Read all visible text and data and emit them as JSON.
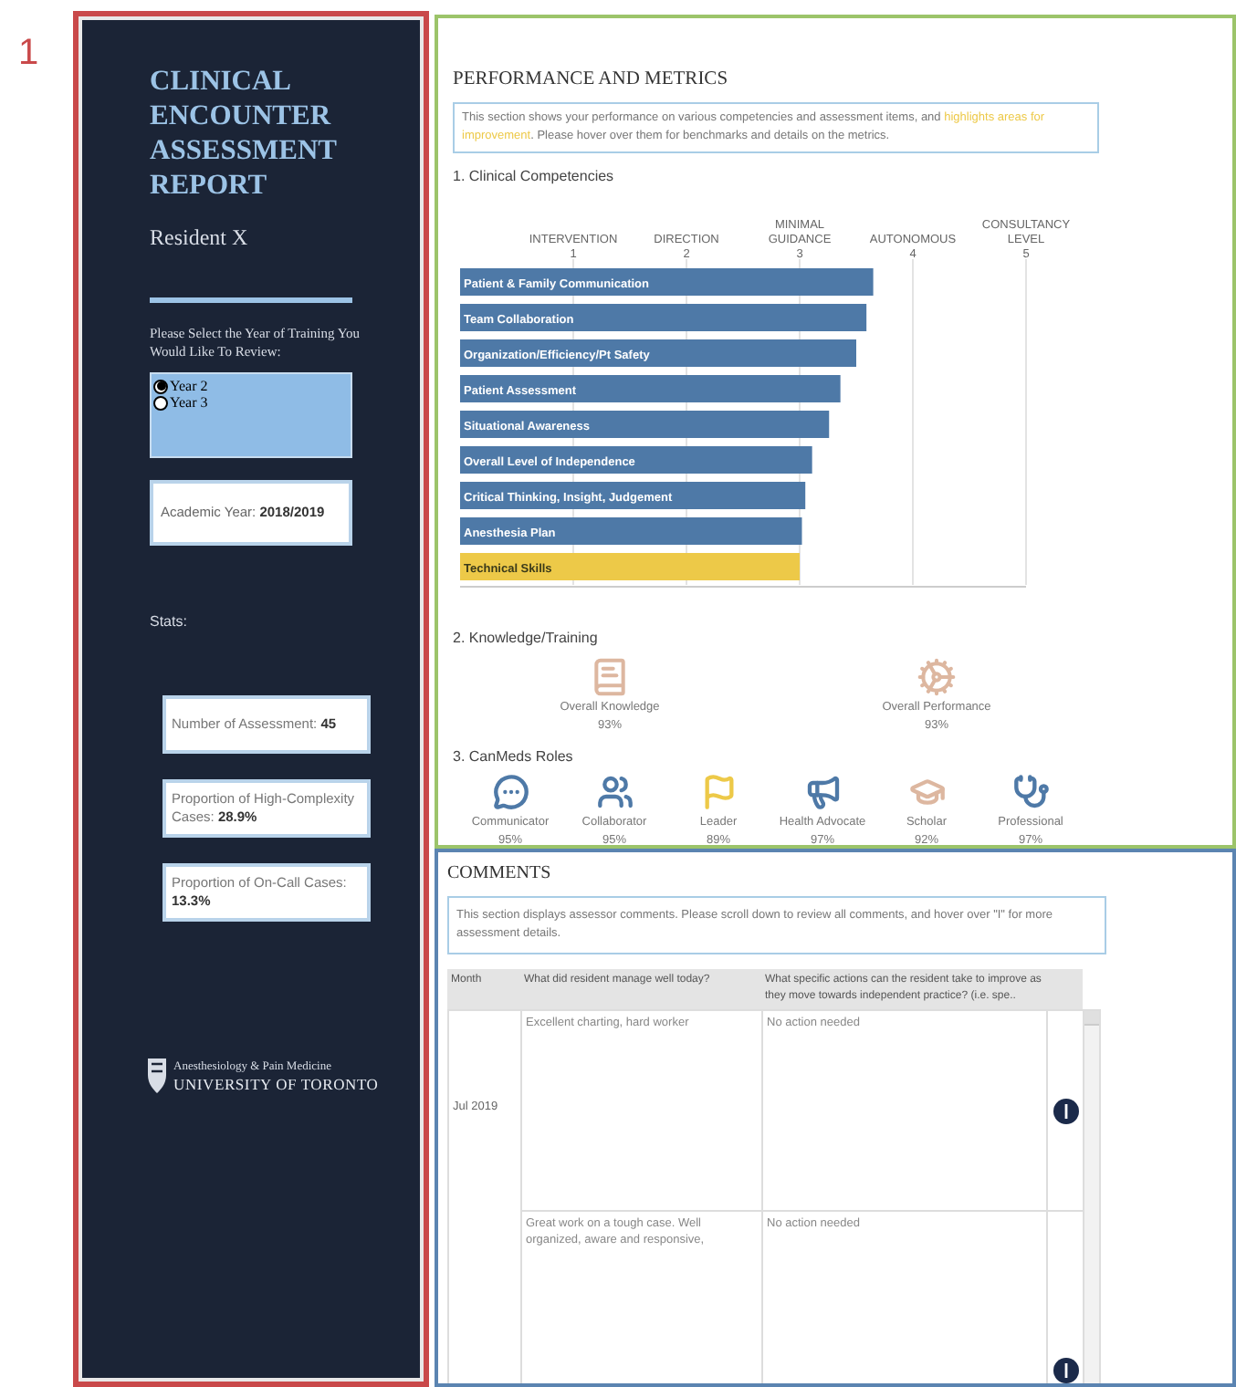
{
  "figure_number": "1",
  "sidebar": {
    "title": "CLINICAL ENCOUNTER ASSESSMENT REPORT",
    "subtitle": "Resident X",
    "prompt": "Please Select the Year of Training You Would Like To Review:",
    "years": [
      {
        "label": "Year 2",
        "selected": true
      },
      {
        "label": "Year 3",
        "selected": false
      }
    ],
    "academic_year": {
      "label": "Academic Year:",
      "value": "2018/2019"
    },
    "stats_heading": "Stats:",
    "stats": [
      {
        "label": "Number of Assessment:",
        "value": "45"
      },
      {
        "label": "Proportion of High-Complexity Cases:",
        "value": "28.9%"
      },
      {
        "label": "Proportion of On-Call Cases:",
        "value": "13.3%"
      }
    ],
    "logo": {
      "department": "Anesthesiology & Pain Medicine",
      "university": "UNIVERSITY OF TORONTO"
    }
  },
  "performance": {
    "title": "PERFORMANCE AND METRICS",
    "description": {
      "before": "This section shows your performance on various competencies and assessment items, and ",
      "highlight": "highlights areas for improvement",
      "after": ". Please hover over them for benchmarks and details on the metrics."
    },
    "competencies": {
      "heading": "1. Clinical Competencies",
      "chart_data": {
        "type": "bar",
        "orientation": "horizontal",
        "categories": [
          "Patient & Family Communication",
          "Team Collaboration",
          "Organization/Efficiency/Pt Safety",
          "Patient Assessment",
          "Situational Awareness",
          "Overall Level of Independence",
          "Critical Thinking, Insight, Judgement",
          "Anesthesia Plan",
          "Technical Skills"
        ],
        "series": [
          {
            "color": "#4e79a7",
            "values": [
              3.65,
              3.59,
              3.5,
              3.36,
              3.26,
              3.11,
              3.05,
              3.02,
              null
            ]
          },
          {
            "color": "#edc948",
            "values": [
              null,
              null,
              null,
              null,
              null,
              null,
              null,
              null,
              3.0
            ]
          }
        ],
        "xlim": [
          0,
          5
        ],
        "grid": true,
        "xticks": [
          1,
          2,
          3,
          4,
          5
        ]
      },
      "level_names": [
        "INTERVENTION",
        "DIRECTION",
        "MINIMAL GUIDANCE",
        "AUTONOMOUS",
        "CONSULTANCY LEVEL"
      ]
    },
    "knowledge": {
      "heading": "2. Knowledge/Training",
      "items": [
        {
          "label": "Overall Knowledge",
          "value": "93%"
        },
        {
          "label": "Overall Performance",
          "value": "93%"
        }
      ]
    },
    "canmeds": {
      "heading": "3. CanMeds Roles",
      "roles": [
        {
          "label": "Communicator",
          "value": "95%",
          "color": "#4e79a7"
        },
        {
          "label": "Collaborator",
          "value": "95%",
          "color": "#4e79a7"
        },
        {
          "label": "Leader",
          "value": "89%",
          "color": "#edc948"
        },
        {
          "label": "Health Advocate",
          "value": "97%",
          "color": "#4e79a7"
        },
        {
          "label": "Scholar",
          "value": "92%",
          "color": "#ddb7a0"
        },
        {
          "label": "Professional",
          "value": "97%",
          "color": "#4e79a7"
        }
      ]
    }
  },
  "comments": {
    "title": "COMMENTS",
    "description": "This section displays assessor comments. Please scroll down to review all comments, and hover over \"I\" for more assessment details.",
    "table": {
      "columns": [
        "Month",
        "What did resident manage well today?",
        "What specific actions can the resident take to improve as they move towards independent practice? (i.e. spe.."
      ],
      "month": "Jul 2019",
      "rows": [
        {
          "managed_well": "Excellent charting, hard worker",
          "actions": "No action needed"
        },
        {
          "managed_well": "Great work on a tough case. Well organized, aware and responsive,",
          "actions": "No action needed"
        }
      ]
    }
  }
}
